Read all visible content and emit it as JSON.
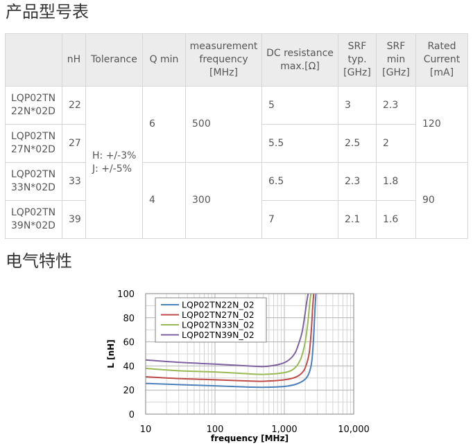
{
  "sections": {
    "products_title": "产品型号表",
    "electrical_title": "电气特性"
  },
  "table": {
    "headers": {
      "blank": "",
      "nh": "nH",
      "tolerance": "Tolerance",
      "qmin": "Q min",
      "freq": [
        "measurement",
        "frequency",
        "[MHz]"
      ],
      "dcr": [
        "DC resistance",
        "max.[Ω]"
      ],
      "srf_typ": [
        "SRF",
        "typ.",
        "[GHz]"
      ],
      "srf_min": [
        "SRF",
        "min",
        "[GHz]"
      ],
      "current": [
        "Rated",
        "Current",
        "[mA]"
      ]
    },
    "rows": [
      {
        "part": [
          "LQP02TN",
          "22N*02D"
        ],
        "nh": "22",
        "dcr": "5",
        "srf_typ": "3",
        "srf_min": "2.3"
      },
      {
        "part": [
          "LQP02TN",
          "27N*02D"
        ],
        "nh": "27",
        "dcr": "5.5",
        "srf_typ": "2.5",
        "srf_min": "2"
      },
      {
        "part": [
          "LQP02TN",
          "33N*02D"
        ],
        "nh": "33",
        "dcr": "6.5",
        "srf_typ": "2.3",
        "srf_min": "1.8"
      },
      {
        "part": [
          "LQP02TN",
          "39N*02D"
        ],
        "nh": "39",
        "dcr": "7",
        "srf_typ": "2.1",
        "srf_min": "1.6"
      }
    ],
    "merged": {
      "tolerance": [
        "H: +/-3%",
        "J: +/-5%"
      ],
      "q_a": "6",
      "freq_a": "500",
      "current_a": "120",
      "q_b": "4",
      "freq_b": "300",
      "current_b": "90"
    }
  },
  "chart_data": {
    "type": "line",
    "xlabel": "frequency [MHz]",
    "ylabel": "L [nH]",
    "x_scale": "log",
    "xlim": [
      10,
      10000
    ],
    "ylim": [
      0,
      100
    ],
    "x_ticks": [
      "10",
      "100",
      "1,000",
      "10,000"
    ],
    "y_ticks": [
      "0",
      "20",
      "40",
      "60",
      "80",
      "100"
    ],
    "grid": true,
    "legend_position": "top-left",
    "series": [
      {
        "name": "LQP02TN22N_02",
        "color": "#4a7ebb",
        "x": [
          10,
          30,
          100,
          300,
          500,
          1000,
          1500,
          2000,
          2300,
          2500,
          2650,
          2750,
          2850
        ],
        "y": [
          25.5,
          24.5,
          23.5,
          22.5,
          22.3,
          23,
          25,
          29,
          35,
          45,
          65,
          85,
          100
        ]
      },
      {
        "name": "LQP02TN27N_02",
        "color": "#be4b48",
        "x": [
          10,
          30,
          100,
          300,
          500,
          1000,
          1500,
          1900,
          2150,
          2300,
          2450,
          2550,
          2650
        ],
        "y": [
          31,
          29.5,
          28.5,
          27.5,
          27.3,
          28.5,
          31,
          36,
          44,
          52,
          70,
          87,
          100
        ]
      },
      {
        "name": "LQP02TN33N_02",
        "color": "#98b954",
        "x": [
          10,
          30,
          100,
          300,
          500,
          1000,
          1400,
          1700,
          1900,
          2050,
          2200,
          2320,
          2420
        ],
        "y": [
          38,
          36,
          35,
          33.5,
          33,
          34.5,
          38,
          45,
          54,
          64,
          78,
          92,
          100
        ]
      },
      {
        "name": "LQP02TN39N_02",
        "color": "#7d60a0",
        "x": [
          10,
          30,
          100,
          300,
          500,
          800,
          1100,
          1400,
          1600,
          1800,
          1950,
          2100,
          2200
        ],
        "y": [
          45,
          43,
          41.5,
          40,
          39.5,
          41,
          44,
          50,
          58,
          68,
          80,
          93,
          100
        ]
      }
    ]
  }
}
